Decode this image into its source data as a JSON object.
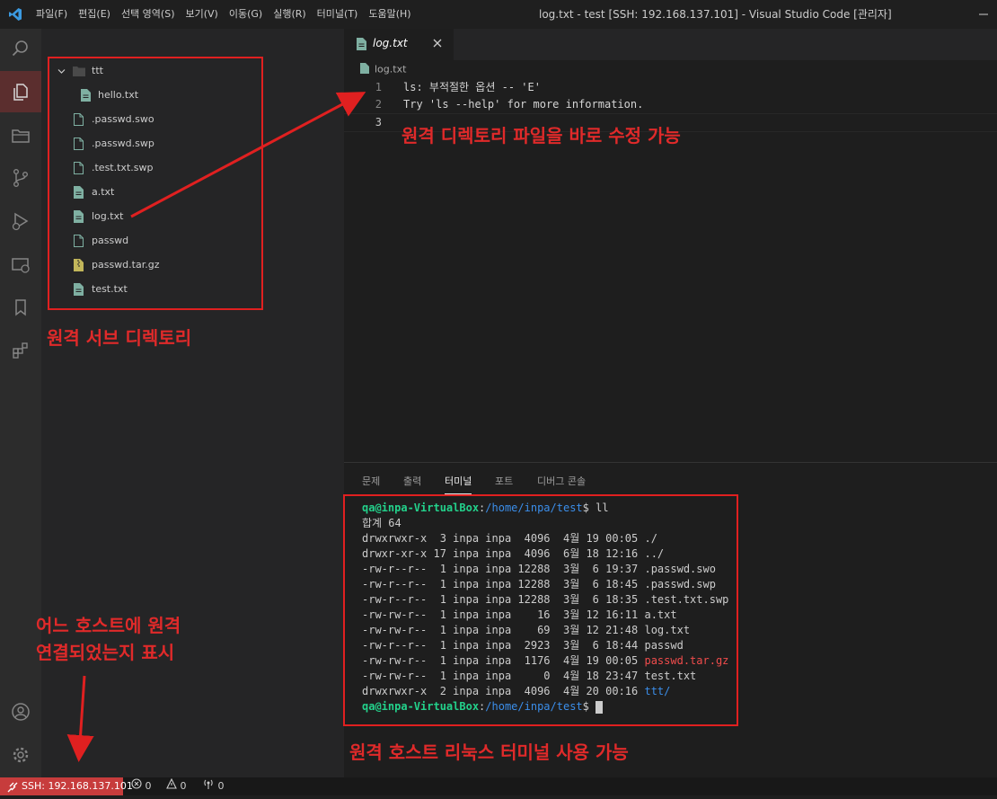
{
  "menu": [
    "파일(F)",
    "편집(E)",
    "선택 영역(S)",
    "보기(V)",
    "이동(G)",
    "실행(R)",
    "터미널(T)",
    "도움말(H)"
  ],
  "window_title": "log.txt - test [SSH: 192.168.137.101] - Visual Studio Code [관리자]",
  "explorer": {
    "folder": "ttt",
    "items": [
      {
        "name": "hello.txt",
        "icon": "file-text-icon",
        "nested": true
      },
      {
        "name": ".passwd.swo",
        "icon": "file-icon"
      },
      {
        "name": ".passwd.swp",
        "icon": "file-icon"
      },
      {
        "name": ".test.txt.swp",
        "icon": "file-icon"
      },
      {
        "name": "a.txt",
        "icon": "file-text-icon"
      },
      {
        "name": "log.txt",
        "icon": "file-text-icon"
      },
      {
        "name": "passwd",
        "icon": "file-icon"
      },
      {
        "name": "passwd.tar.gz",
        "icon": "archive-icon"
      },
      {
        "name": "test.txt",
        "icon": "file-text-icon"
      }
    ]
  },
  "editor": {
    "tab": "log.txt",
    "breadcrumb": "log.txt",
    "lines": [
      "ls: 부적절한 옵션 -- 'E'",
      "Try 'ls --help' for more information.",
      ""
    ]
  },
  "panel": {
    "tabs": [
      "문제",
      "출력",
      "터미널",
      "포트",
      "디버그 콘솔"
    ],
    "active_tab": "터미널",
    "prompt_user": "qa@inpa-VirtualBox",
    "prompt_path": "/home/inpa/test",
    "command": "ll",
    "total": "합계 64",
    "listing": [
      {
        "meta": "drwxrwxr-x  3 inpa inpa  4096  4월 19 00:05 ",
        "name": "./",
        "color": "default"
      },
      {
        "meta": "drwxr-xr-x 17 inpa inpa  4096  6월 18 12:16 ",
        "name": "../",
        "color": "default"
      },
      {
        "meta": "-rw-r--r--  1 inpa inpa 12288  3월  6 19:37 ",
        "name": ".passwd.swo",
        "color": "default"
      },
      {
        "meta": "-rw-r--r--  1 inpa inpa 12288  3월  6 18:45 ",
        "name": ".passwd.swp",
        "color": "default"
      },
      {
        "meta": "-rw-r--r--  1 inpa inpa 12288  3월  6 18:35 ",
        "name": ".test.txt.swp",
        "color": "default"
      },
      {
        "meta": "-rw-rw-r--  1 inpa inpa    16  3월 12 16:11 ",
        "name": "a.txt",
        "color": "default"
      },
      {
        "meta": "-rw-rw-r--  1 inpa inpa    69  3월 12 21:48 ",
        "name": "log.txt",
        "color": "default"
      },
      {
        "meta": "-rw-r--r--  1 inpa inpa  2923  3월  6 18:44 ",
        "name": "passwd",
        "color": "default"
      },
      {
        "meta": "-rw-rw-r--  1 inpa inpa  1176  4월 19 00:05 ",
        "name": "passwd.tar.gz",
        "color": "#f14c4c"
      },
      {
        "meta": "-rw-rw-r--  1 inpa inpa     0  4월 18 23:47 ",
        "name": "test.txt",
        "color": "default"
      },
      {
        "meta": "drwxrwxr-x  2 inpa inpa  4096  4월 20 00:16 ",
        "name": "ttt/",
        "color": "#3b8eea"
      }
    ]
  },
  "annotations": {
    "subdir": "원격 서브 디렉토리",
    "edit": "원격 디렉토리 파일을 바로 수정 가능",
    "host_line1": "어느 호스트에 원격",
    "host_line2": "연결되었는지 표시",
    "terminal": "원격 호스트 리눅스 터미널 사용 가능"
  },
  "status": {
    "remote": "SSH: 192.168.137.101",
    "errors": "0",
    "warnings": "0",
    "ports": "0"
  },
  "colors": {
    "remote_bg": "#c73c3c",
    "annotation_red": "#e02a2a",
    "accent": "#3b8eea"
  }
}
